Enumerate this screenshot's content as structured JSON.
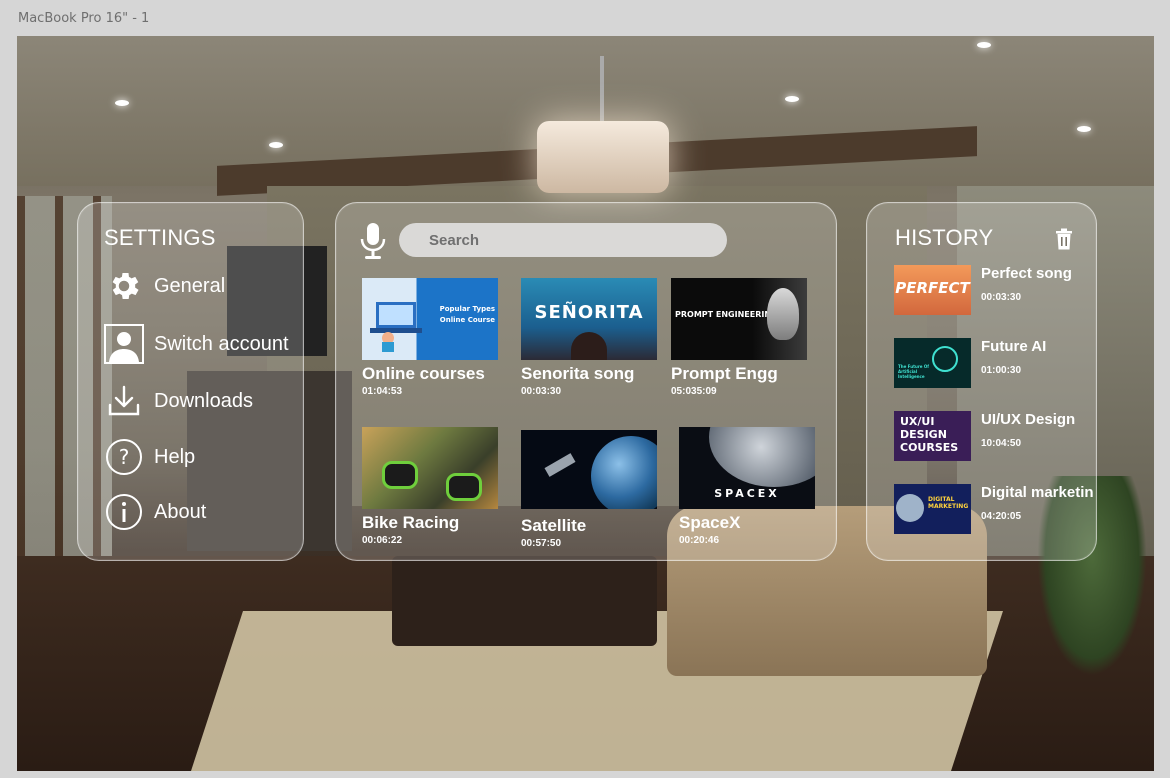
{
  "frame_label": "MacBook Pro 16\" - 1",
  "settings": {
    "title": "SETTINGS",
    "items": [
      {
        "label": "General",
        "icon": "gear-icon"
      },
      {
        "label": "Switch account",
        "icon": "user-account-icon"
      },
      {
        "label": "Downloads",
        "icon": "download-icon"
      },
      {
        "label": "Help",
        "icon": "help-icon"
      },
      {
        "label": "About",
        "icon": "info-icon"
      }
    ]
  },
  "search": {
    "placeholder": "Search"
  },
  "videos": [
    {
      "title": "Online courses",
      "duration": "01:04:53",
      "thumb_text": "Popular Types Online Course"
    },
    {
      "title": "Senorita song",
      "duration": "00:03:30",
      "thumb_text": "SEÑORITA"
    },
    {
      "title": "Prompt Engg",
      "duration": "05:035:09",
      "thumb_text": "PROMPT ENGINEERING"
    },
    {
      "title": "Bike Racing",
      "duration": "00:06:22",
      "thumb_text": ""
    },
    {
      "title": "Satellite",
      "duration": "00:57:50",
      "thumb_text": ""
    },
    {
      "title": "SpaceX",
      "duration": "00:20:46",
      "thumb_text": "SPACEX"
    }
  ],
  "history": {
    "title": "HISTORY",
    "items": [
      {
        "title": "Perfect song",
        "duration": "00:03:30",
        "thumb_text": "PERFECT"
      },
      {
        "title": "Future AI",
        "duration": "01:00:30",
        "thumb_text": "The Future Of Artificial Intelligence"
      },
      {
        "title": "UI/UX Design",
        "duration": "10:04:50",
        "thumb_text": "UX/UI DESIGN COURSES"
      },
      {
        "title": "Digital marketin",
        "duration": "04:20:05",
        "thumb_text": "DIGITAL MARKETING"
      }
    ]
  },
  "colors": {
    "panel_text": "#ffffff",
    "search_bg": "#e6e6e6",
    "search_text": "#707070"
  }
}
